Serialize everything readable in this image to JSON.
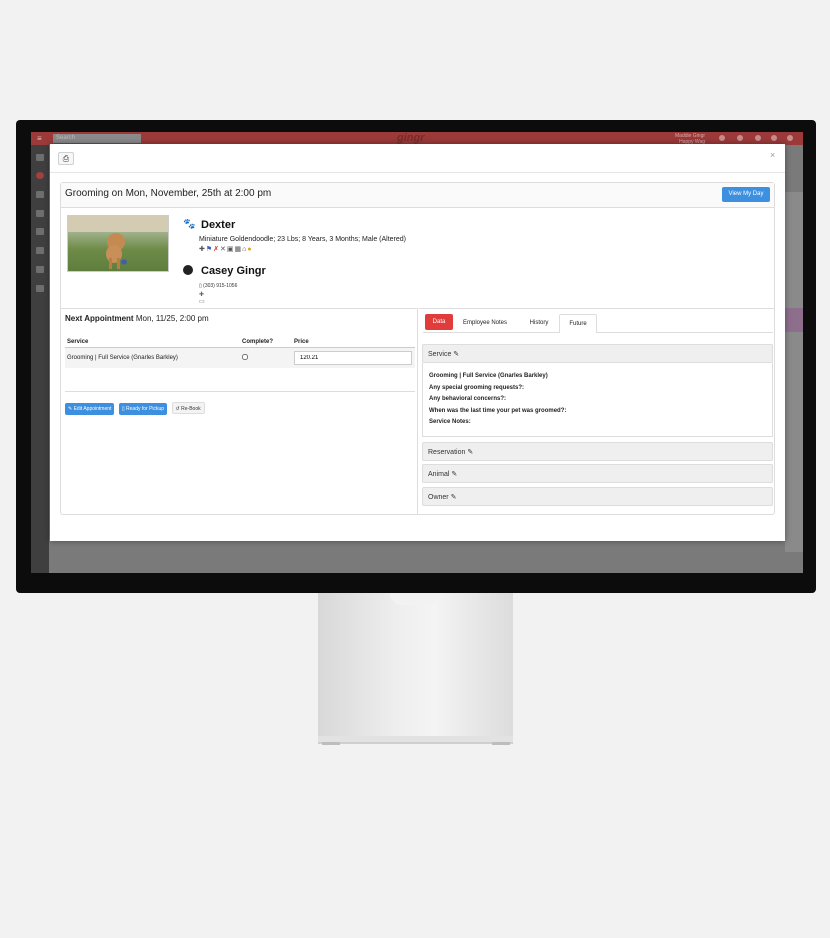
{
  "topbar": {
    "search_placeholder": "Search",
    "logo": "gingr",
    "user_line1": "Maddie Gingr",
    "user_line2": "Happy Wag"
  },
  "modal": {
    "title": "Grooming on Mon, November, 25th at 2:00 pm",
    "view_my_day": "View My Day",
    "close": "×"
  },
  "pet": {
    "name": "Dexter",
    "description": "Miniature Goldendoodle; 23 Lbs; 8 Years, 3 Months; Male (Altered)",
    "icons": [
      "plus-icon",
      "flag-icon",
      "utensils-icon",
      "x-icon",
      "id-card-icon",
      "calendar-icon",
      "home-icon",
      "coin-icon"
    ]
  },
  "owner": {
    "name": "Casey Gingr",
    "phone": "(303) 915-1056"
  },
  "appointment": {
    "next_label": "Next Appointment",
    "next_value": "Mon, 11/25, 2:00 pm",
    "columns": [
      "Service",
      "Complete?",
      "Price"
    ],
    "rows": [
      {
        "service": "Grooming | Full Service (Gnarles Barkley)",
        "complete": false,
        "price": "120.21"
      }
    ],
    "buttons": {
      "edit": "Edit Appointment",
      "ready": "Ready for Pickup",
      "rebook": "Re-Book"
    }
  },
  "tabs": {
    "data": "Data",
    "notes": "Employee Notes",
    "history": "History",
    "future": "Future"
  },
  "accordion": {
    "service": "Service",
    "reservation": "Reservation",
    "animal": "Animal",
    "owner": "Owner"
  },
  "service_details": {
    "line1": "Grooming | Full Service (Gnarles Barkley)",
    "line2": "Any special grooming requests?:",
    "line3": "Any behavioral concerns?:",
    "line4": "When was the last time your pet was groomed?:",
    "line5": "Service Notes:"
  },
  "colors": {
    "accent": "#3d8fe0",
    "active_tab": "#e03c3c",
    "topbar": "#9c3a3a"
  }
}
